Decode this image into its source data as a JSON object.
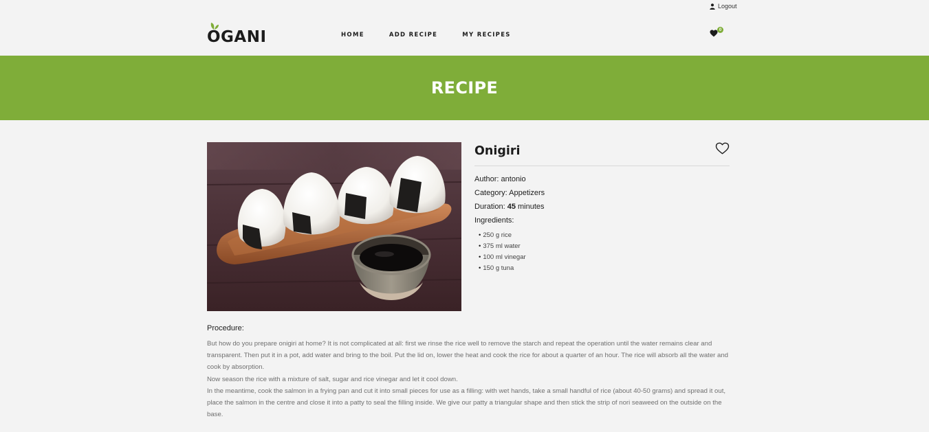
{
  "header": {
    "logout_label": "Logout",
    "logo_text": "OGANI",
    "nav": [
      "HOME",
      "ADD RECIPE",
      "MY RECIPES"
    ],
    "favorites_count": "0"
  },
  "banner": {
    "title": "RECIPE"
  },
  "recipe": {
    "name": "Onigiri",
    "author_label": "Author:",
    "author": "antonio",
    "category_label": "Category:",
    "category": "Appetizers",
    "duration_label": "Duration:",
    "duration_value": "45",
    "duration_unit": "minutes",
    "ingredients_label": "Ingredients:",
    "ingredients": [
      "250 g rice",
      "375 ml water",
      "100 ml vinegar",
      "150 g tuna"
    ],
    "procedure_label": "Procedure:",
    "procedure": [
      "But how do you prepare onigiri at home? It is not complicated at all: first we rinse the rice well to remove the starch and repeat the operation until the water remains clear and transparent. Then put it in a pot, add water and bring to the boil. Put the lid on, lower the heat and cook the rice for about a quarter of an hour. The rice will absorb all the water and cook by absorption.",
      "Now season the rice with a mixture of salt, sugar and rice vinegar and let it cool down.",
      "In the meantime, cook the salmon in a frying pan and cut it into small pieces for use as a filling: with wet hands, take a small handful of rice (about 40-50 grams) and spread it out, place the salmon in the centre and close it into a patty to seal the filling inside. We give our patty a triangular shape and then stick the strip of nori seaweed on the outside on the base."
    ]
  },
  "colors": {
    "accent": "#7fad39",
    "background": "#f3f3f3",
    "text": "#1c1c1c"
  },
  "icons": {
    "user": "user-icon",
    "favorites": "heart-icon",
    "add_favorite": "heart-outline-icon"
  }
}
